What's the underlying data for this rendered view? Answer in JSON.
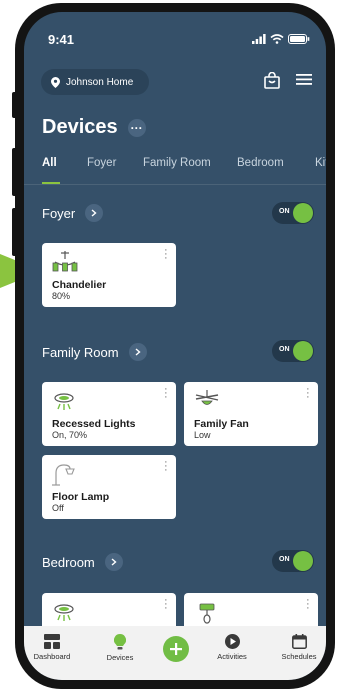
{
  "status": {
    "time": "9:41"
  },
  "header": {
    "home_name": "Johnson Home",
    "title": "Devices",
    "more_glyph": "···"
  },
  "tabs": [
    {
      "label": "All",
      "active": true
    },
    {
      "label": "Foyer"
    },
    {
      "label": "Family Room"
    },
    {
      "label": "Bedroom"
    },
    {
      "label": "Kitchen"
    }
  ],
  "sections": [
    {
      "name": "Foyer",
      "toggle": "ON",
      "devices": [
        {
          "name": "Chandelier",
          "state": "80%",
          "icon": "chandelier-icon"
        }
      ]
    },
    {
      "name": "Family Room",
      "toggle": "ON",
      "devices": [
        {
          "name": "Recessed Lights",
          "state": "On, 70%",
          "icon": "recessed-light-icon"
        },
        {
          "name": "Family Fan",
          "state": "Low",
          "icon": "ceiling-fan-icon"
        },
        {
          "name": "Floor Lamp",
          "state": "Off",
          "icon": "floor-lamp-icon"
        }
      ]
    },
    {
      "name": "Bedroom",
      "toggle": "ON",
      "devices": [
        {
          "name": "",
          "state": "",
          "icon": "recessed-light-icon"
        },
        {
          "name": "",
          "state": "",
          "icon": "pendant-light-icon"
        }
      ]
    }
  ],
  "nav": [
    {
      "label": "Dashboard",
      "icon": "dashboard-icon"
    },
    {
      "label": "Devices",
      "icon": "bulb-icon"
    },
    {
      "label": "",
      "icon": "plus-icon"
    },
    {
      "label": "Activities",
      "icon": "play-icon"
    },
    {
      "label": "Schedules",
      "icon": "calendar-icon"
    }
  ],
  "colors": {
    "background": "#355069",
    "accent": "#76c043",
    "card": "#ffffff",
    "nav": "#f2f2f2"
  }
}
